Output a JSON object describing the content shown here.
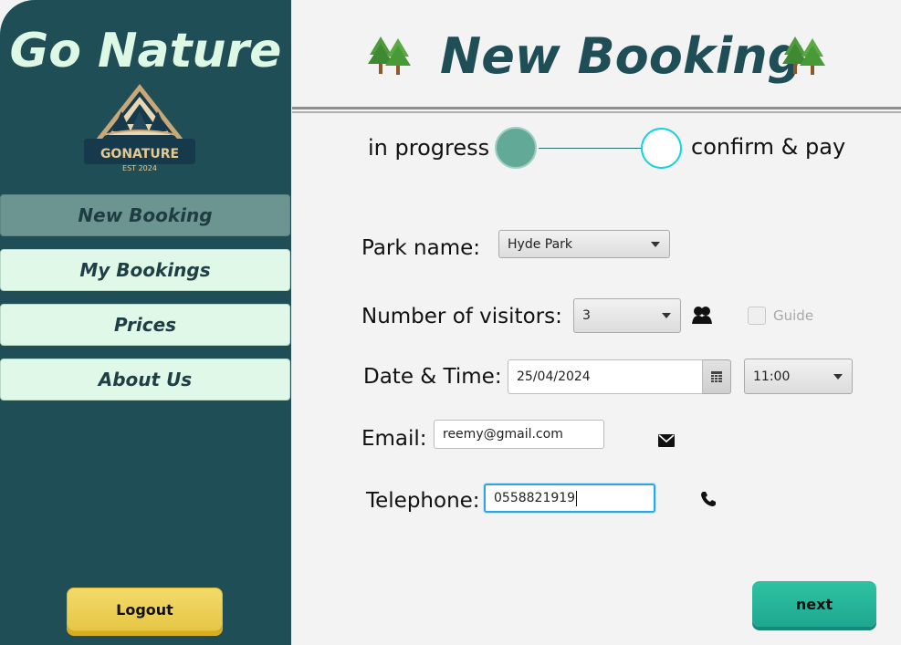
{
  "sidebar": {
    "brand": "Go Nature",
    "logo_text": "GONATURE",
    "logo_subtext": "EST 2024",
    "items": [
      {
        "label": "New Booking",
        "active": true
      },
      {
        "label": "My Bookings",
        "active": false
      },
      {
        "label": "Prices",
        "active": false
      },
      {
        "label": "About Us",
        "active": false
      }
    ],
    "logout_label": "Logout"
  },
  "header": {
    "title": "New Booking",
    "decor_icon": "tree-icon"
  },
  "progress": {
    "step1_label": "in progress",
    "step2_label": "confirm & pay"
  },
  "form": {
    "park_label": "Park name:",
    "park_value": "Hyde Park",
    "visitors_label": "Number of visitors:",
    "visitors_value": "3",
    "guide_label": "Guide",
    "guide_checked": false,
    "date_label": "Date & Time:",
    "date_value": "25/04/2024",
    "time_value": "11:00",
    "email_label": "Email:",
    "email_value": "reemy@gmail.com",
    "phone_label": "Telephone:",
    "phone_value": "0558821919"
  },
  "actions": {
    "next_label": "next"
  },
  "colors": {
    "sidebar_bg": "#1f4e57",
    "accent_teal": "#22b59a",
    "logout_yellow": "#ebcd4f",
    "active_step": "#62a997",
    "pending_step_border": "#12d5e0"
  }
}
